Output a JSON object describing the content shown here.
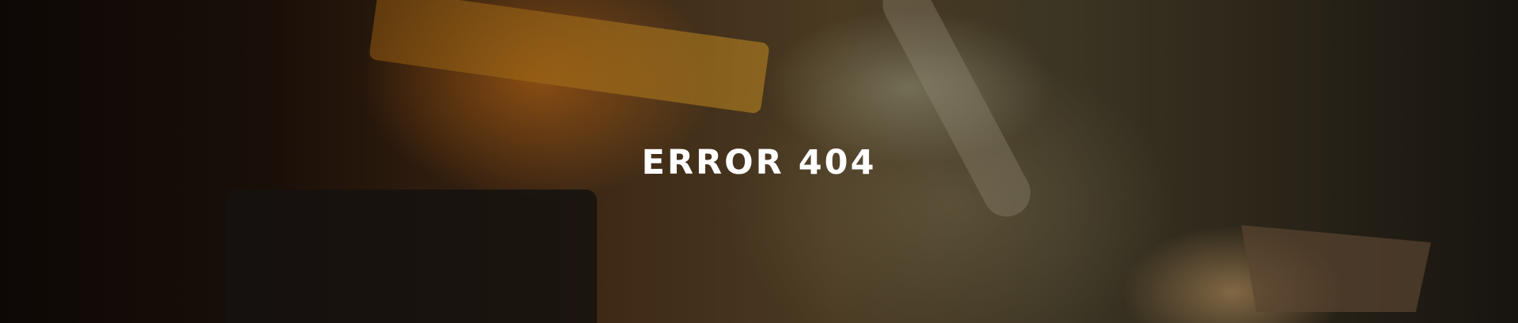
{
  "hero": {
    "title": "ERROR 404"
  }
}
